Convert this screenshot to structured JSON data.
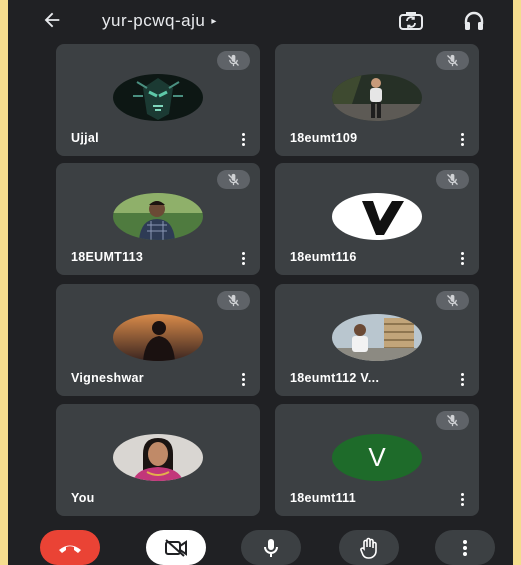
{
  "meeting": {
    "code": "yur-pcwq-aju",
    "caret": "▸"
  },
  "topbar": {
    "back_icon": "back-arrow-icon",
    "icons": [
      "switch-camera-icon",
      "headphones-icon"
    ]
  },
  "participants": [
    {
      "name": "Ujjal",
      "muted": true,
      "avatar": "photo"
    },
    {
      "name": "18eumt109",
      "muted": true,
      "avatar": "photo"
    },
    {
      "name": "18EUMT113",
      "muted": true,
      "avatar": "photo"
    },
    {
      "name": "18eumt116",
      "muted": true,
      "avatar": "logo"
    },
    {
      "name": "Vigneshwar",
      "muted": true,
      "avatar": "photo"
    },
    {
      "name": "18eumt112 V...",
      "muted": true,
      "avatar": "photo"
    },
    {
      "name": "You",
      "muted": false,
      "avatar": "photo"
    },
    {
      "name": "18eumt111",
      "muted": true,
      "avatar": "initial",
      "initial": "V"
    }
  ],
  "controls": [
    "end-call",
    "camera-off",
    "microphone",
    "raise-hand",
    "more-options"
  ],
  "colors": {
    "background": "#202124",
    "tile": "#3c4043",
    "end_call": "#ea4335",
    "avatar_green": "#1e6b2a",
    "outer_border": "#f5dd8f"
  }
}
